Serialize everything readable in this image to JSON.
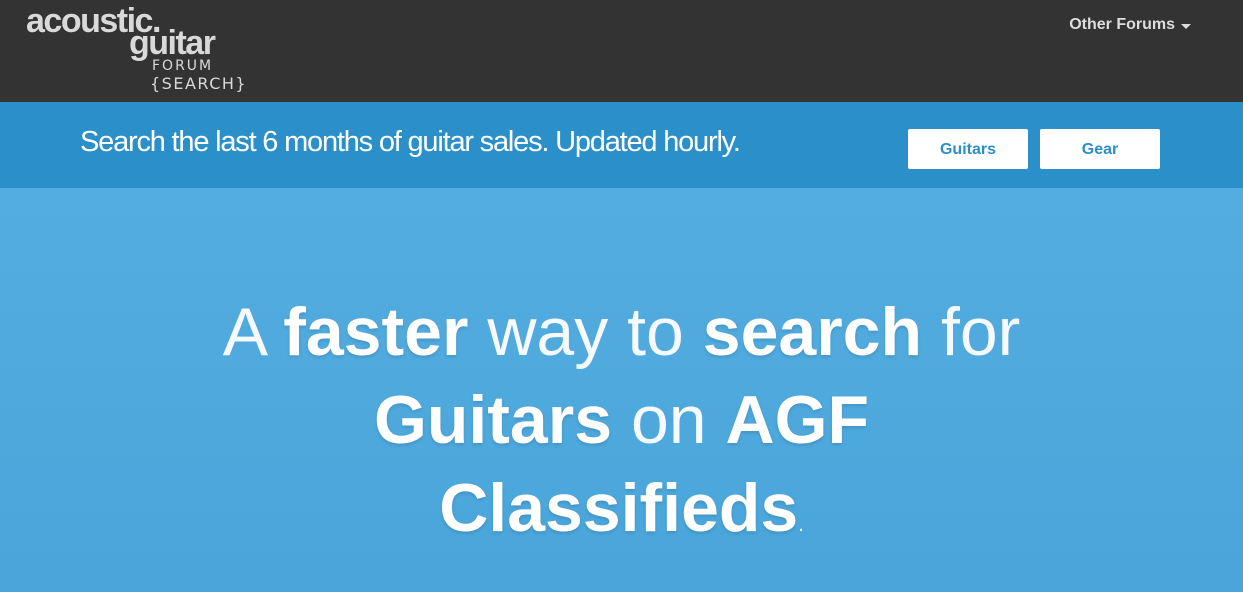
{
  "header": {
    "logo": {
      "line1": "acoustic.",
      "line2": "guitar",
      "line3": "FORUM",
      "line4": "{SEARCH}"
    },
    "other_forums_label": "Other Forums"
  },
  "banner": {
    "text": "Search the last 6 months of guitar sales. Updated hourly.",
    "buttons": {
      "guitars": "Guitars",
      "gear": "Gear"
    }
  },
  "hero": {
    "line1": {
      "w1": "A",
      "w2": "faster",
      "w3": "way to",
      "w4": "search",
      "w5": "for"
    },
    "line2": {
      "w1": "Guitars",
      "w2": "on",
      "w3": "AGF"
    },
    "line3": {
      "w1": "Classifieds",
      "w2": "."
    }
  },
  "colors": {
    "topbar": "#333333",
    "banner": "#2b8fc9",
    "hero": "#4fa9dc",
    "button_text": "#2b8fc9"
  },
  "icons": {
    "dropdown": "caret-down-icon"
  }
}
